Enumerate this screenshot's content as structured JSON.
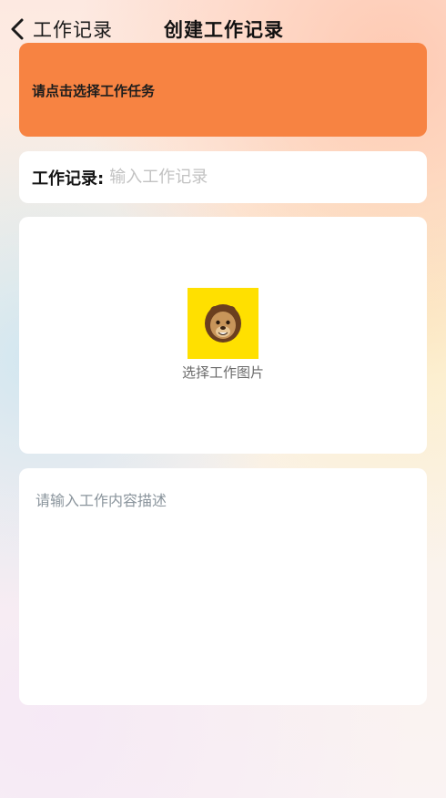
{
  "nav": {
    "back_label": "工作记录",
    "title": "创建工作记录"
  },
  "task_selector": {
    "label": "请点击选择工作任务",
    "color": "#f78342"
  },
  "record_field": {
    "label": "工作记录:",
    "placeholder": "输入工作记录",
    "value": ""
  },
  "image_picker": {
    "label": "选择工作图片",
    "icon": "lion-avatar-icon",
    "background": "#ffe000"
  },
  "description": {
    "placeholder": "请输入工作内容描述",
    "value": ""
  }
}
